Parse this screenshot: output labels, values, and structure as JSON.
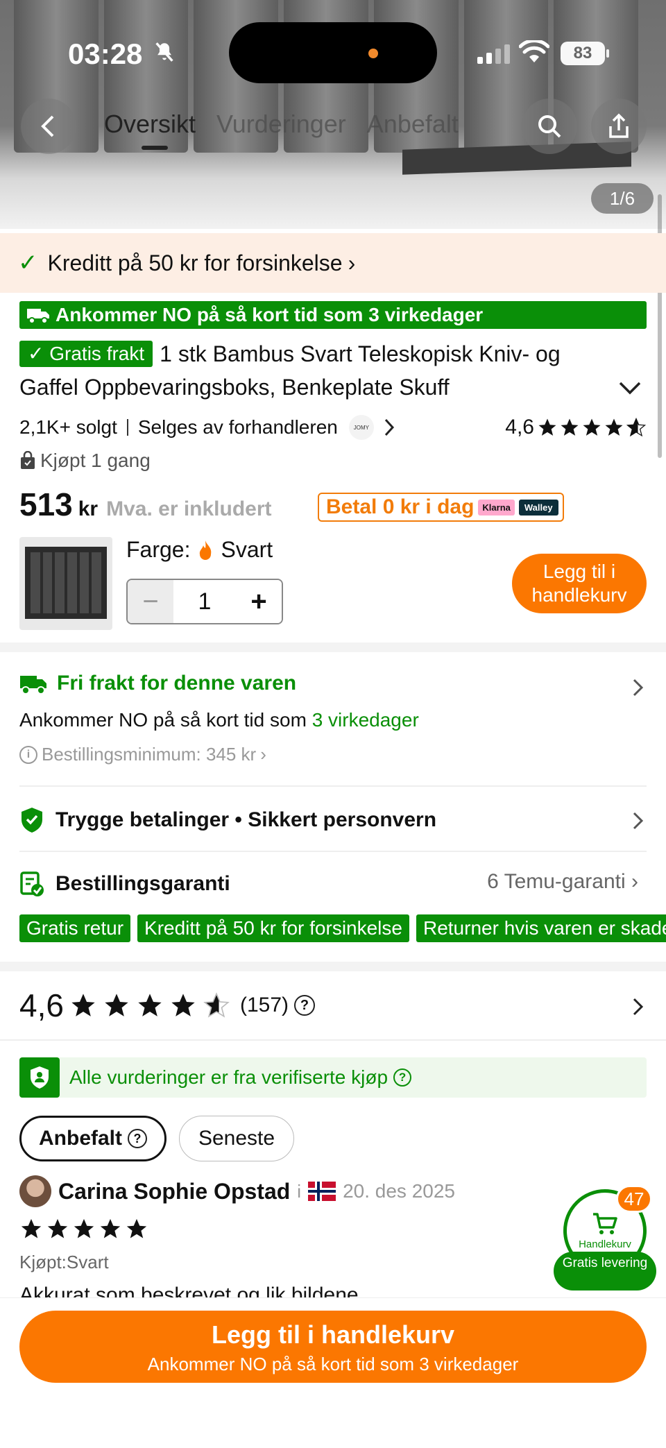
{
  "status_bar": {
    "time": "03:28",
    "battery": "83"
  },
  "nav": {
    "tabs": [
      {
        "label": "Oversikt",
        "active": true
      },
      {
        "label": "Vurderinger",
        "active": false
      },
      {
        "label": "Anbefalt",
        "active": false
      }
    ],
    "image_counter": "1/6"
  },
  "credit_banner": {
    "text": "Kreditt på 50 kr for forsinkelse",
    "chevron": "›"
  },
  "product": {
    "arrival_badge": "Ankommer NO på så kort tid som 3 virkedager",
    "free_shipping_tag": "Gratis frakt",
    "title": "1 stk Bambus Svart Teleskopisk Kniv- og Gaffel Oppbevaringsboks, Benkeplate Skuff",
    "sold": "2,1K+ solgt",
    "seller": "Selges av forhandleren",
    "seller_logo": "JOMY",
    "rating": "4,6",
    "bought": "Kjøpt 1 gang",
    "price": "513",
    "currency": "kr",
    "vat_note": "Mva. er inkludert",
    "pay_today": "Betal 0 kr i dag",
    "pay_partners": [
      "Klarna",
      "Walley"
    ],
    "color_label": "Farge:",
    "color_value": "Svart",
    "quantity": "1",
    "add_to_cart_small": "Legg til i handlekurv",
    "accent_orange": "#fb7701",
    "accent_green": "#0a8f08"
  },
  "shipping": {
    "title": "Fri frakt for denne varen",
    "arrival_prefix": "Ankommer NO på så kort tid som",
    "arrival_days": "3 virkedager",
    "min_order": "Bestillingsminimum: 345 kr",
    "secure": "Trygge betalinger • Sikkert personvern",
    "guarantee": "Bestillingsgaranti",
    "guarantee_count": "6 Temu-garanti",
    "chips": [
      "Gratis retur",
      "Kreditt på 50 kr for forsinkelse",
      "Returner hvis varen er skadet"
    ]
  },
  "reviews": {
    "score": "4,6",
    "count": "(157)",
    "verified": "Alle vurderinger er fra verifiserte kjøp",
    "sort_active": "Anbefalt",
    "sort_inactive": "Seneste",
    "first": {
      "name": "Carina Sophie Opstad",
      "separator": "i",
      "date": "20. des 2025",
      "variant": "Kjøpt:Svart",
      "text": "Akkurat som beskrevet og lik bildene"
    }
  },
  "cart_float": {
    "label": "Handlekurv",
    "count": "47",
    "free_delivery": "Gratis levering"
  },
  "bottom_cta": {
    "line1": "Legg til i handlekurv",
    "line2": "Ankommer NO på så kort tid som 3 virkedager"
  }
}
